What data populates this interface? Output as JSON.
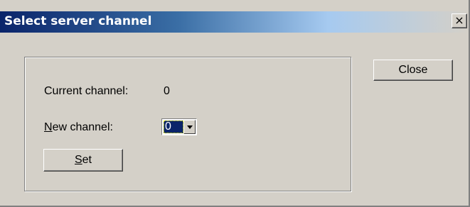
{
  "window": {
    "title": "Select server channel",
    "close_glyph": "×"
  },
  "form": {
    "current_channel_label": "Current channel:",
    "current_channel_value": "0",
    "new_channel_label_mnemonic": "N",
    "new_channel_label_rest": "ew channel:",
    "new_channel_selected": "0",
    "set_button_mnemonic": "S",
    "set_button_rest": "et"
  },
  "actions": {
    "close_label": "Close"
  },
  "colors": {
    "face": "#d4d0c8",
    "title_active": "#0a246a",
    "selection": "#0a246a"
  },
  "icons": {
    "title_close": "close-icon",
    "dropdown": "chevron-down-icon"
  }
}
